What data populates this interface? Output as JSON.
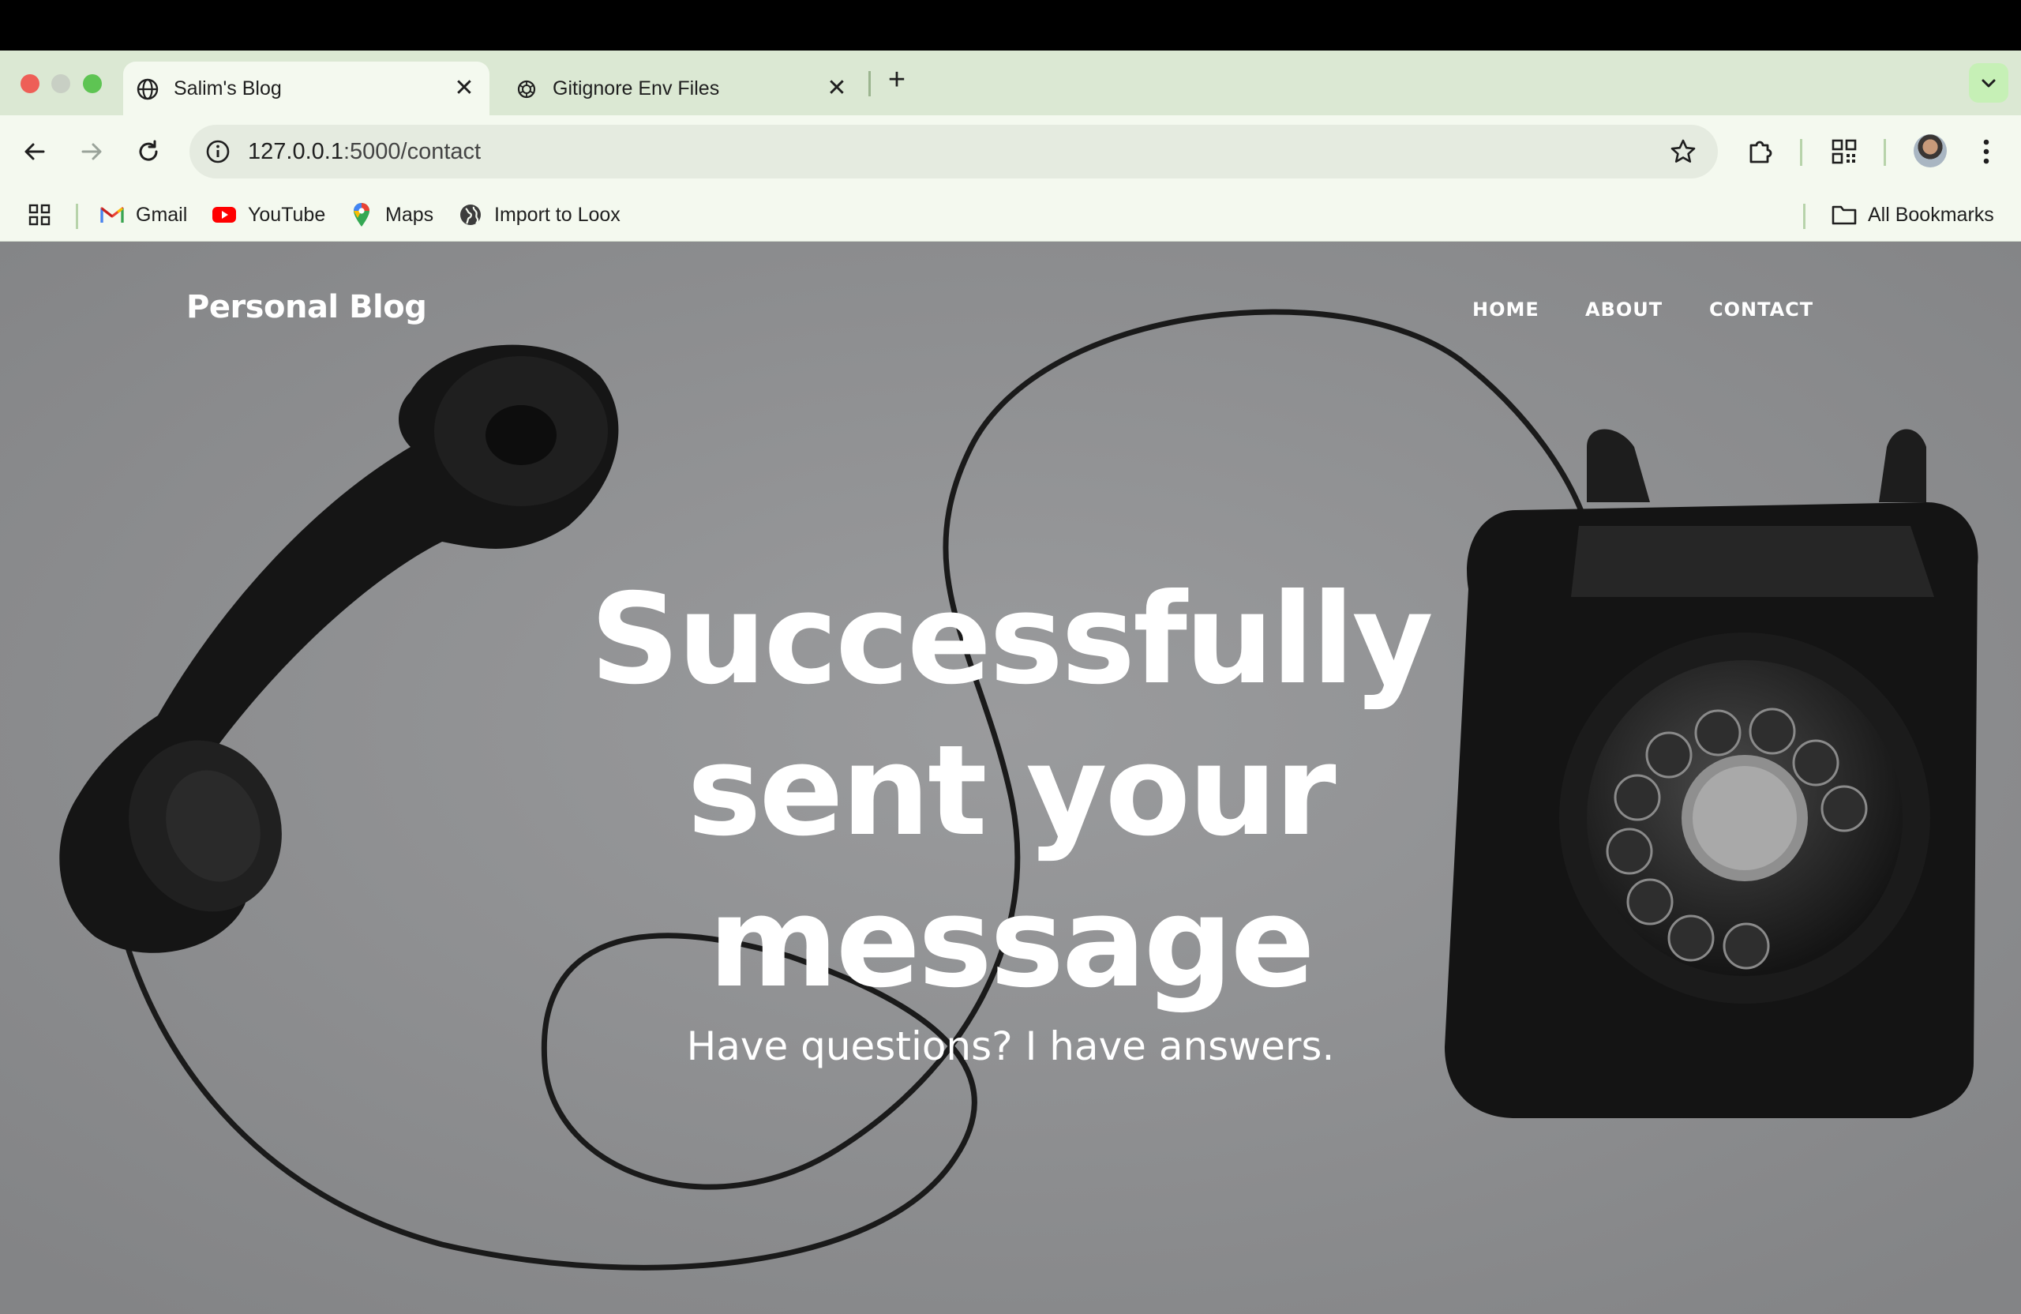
{
  "browser": {
    "tabs": [
      {
        "title": "Salim's Blog",
        "favicon": "globe-icon",
        "active": true
      },
      {
        "title": "Gitignore Env Files",
        "favicon": "openai-icon",
        "active": false
      }
    ],
    "new_tab_icon": "plus-icon",
    "url": {
      "host": "127.0.0.1",
      "path": ":5000/contact"
    },
    "bookmarks": [
      {
        "label": "Gmail",
        "icon": "gmail-icon"
      },
      {
        "label": "YouTube",
        "icon": "youtube-icon"
      },
      {
        "label": "Maps",
        "icon": "maps-icon"
      },
      {
        "label": "Import to Loox",
        "icon": "globe-icon"
      }
    ],
    "all_bookmarks_label": "All Bookmarks"
  },
  "site": {
    "brand": "Personal Blog",
    "nav": [
      "HOME",
      "ABOUT",
      "CONTACT"
    ]
  },
  "hero": {
    "title_lines": [
      "Successfully",
      "sent your",
      "message"
    ],
    "subtitle": "Have questions? I have answers."
  },
  "colors": {
    "tab_strip": "#dbe8d3",
    "toolbar": "#f4f9ef",
    "hero_overlay": "#8d8e90"
  }
}
